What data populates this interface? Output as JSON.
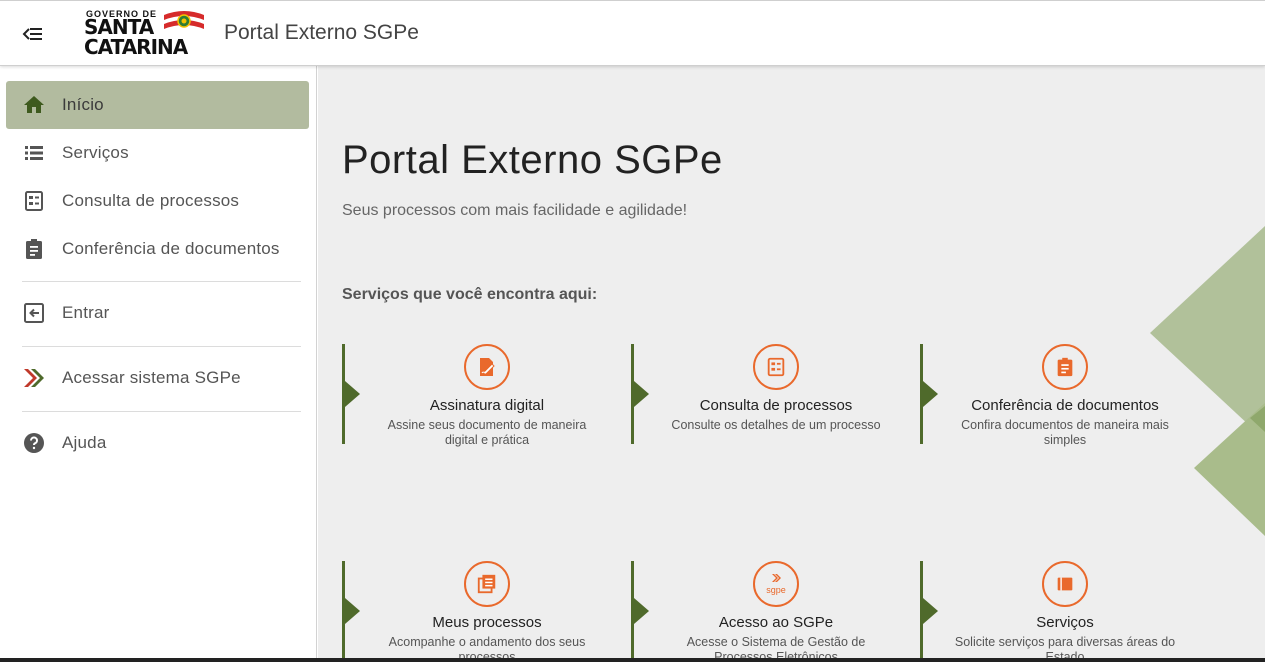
{
  "header": {
    "logo_top": "GOVERNO DE",
    "logo_line1": "SANTA",
    "logo_line2": "CATARINA",
    "app_title": "Portal Externo SGPe"
  },
  "sidebar": {
    "items": [
      {
        "label": "Início",
        "icon": "home-icon",
        "active": true
      },
      {
        "label": "Serviços",
        "icon": "list-icon"
      },
      {
        "label": "Consulta de processos",
        "icon": "process-list-icon"
      },
      {
        "label": "Conferência de documentos",
        "icon": "clipboard-icon"
      },
      {
        "label": "Entrar",
        "icon": "login-icon"
      },
      {
        "label": "Acessar sistema SGPe",
        "icon": "sgpe-arrows-icon"
      },
      {
        "label": "Ajuda",
        "icon": "help-icon"
      }
    ]
  },
  "main": {
    "title": "Portal Externo SGPe",
    "subtitle": "Seus processos com mais facilidade e agilidade!",
    "section_title": "Serviços que você encontra aqui:",
    "cards": [
      {
        "title": "Assinatura digital",
        "desc": "Assine seus documento de maneira digital e prática",
        "icon": "signature-icon"
      },
      {
        "title": "Consulta de processos",
        "desc": "Consulte os detalhes de um processo",
        "icon": "process-list-icon"
      },
      {
        "title": "Conferência de documentos",
        "desc": "Confira documentos de maneira mais simples",
        "icon": "clipboard-icon"
      },
      {
        "title": "Meus processos",
        "desc": "Acompanhe o andamento dos seus processos",
        "icon": "documents-icon"
      },
      {
        "title": "Acesso ao SGPe",
        "desc": "Acesse o Sistema de Gestão de Processos Eletrônicos",
        "icon": "sgpe-logo-icon",
        "icon_text": "sgpe"
      },
      {
        "title": "Serviços",
        "desc": "Solicite serviços para diversas áreas do Estado",
        "icon": "services-icon"
      }
    ]
  },
  "colors": {
    "accent_orange": "#e9692c",
    "brand_green": "#4f6a2b",
    "active_bg": "#b2bb9f",
    "deco_green": "#a9bc8b"
  }
}
